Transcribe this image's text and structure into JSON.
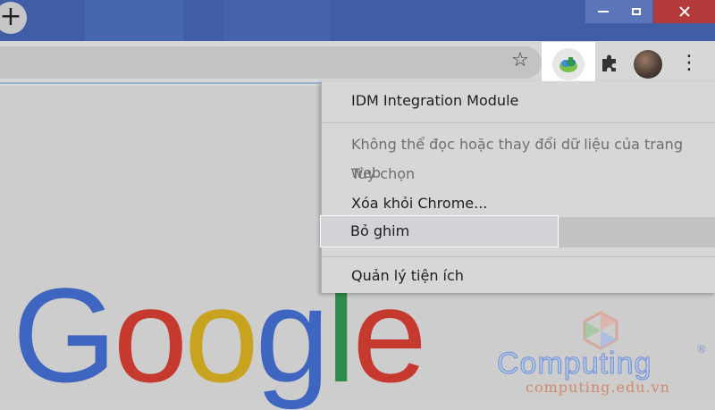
{
  "browser": {
    "new_tab_label": "+",
    "window_controls": {
      "minimize": "minimize-icon",
      "maximize": "maximize-icon",
      "close": "close-icon"
    }
  },
  "toolbar": {
    "bookmark_icon": "star-icon",
    "extension_icon": "idm-icon",
    "extensions_menu_icon": "puzzle-icon",
    "menu_icon": "⋮"
  },
  "context_menu": {
    "title": "IDM Integration Module",
    "items": [
      {
        "label": "Không thể đọc hoặc thay đổi dữ liệu của trang web",
        "enabled": false
      },
      {
        "label": "Tùy chọn",
        "enabled": false
      },
      {
        "label": "Xóa khỏi Chrome...",
        "enabled": true
      },
      {
        "label": "Bỏ ghim",
        "enabled": true,
        "highlighted": true
      },
      {
        "label": "Quản lý tiện ích",
        "enabled": true
      }
    ]
  },
  "page": {
    "logo_letters": [
      "G",
      "o",
      "o",
      "g",
      "l",
      "e"
    ]
  },
  "watermark": {
    "brand": "Computing",
    "registered": "®",
    "url": "computing.edu.vn"
  },
  "colors": {
    "google_blue": "#3e66c0",
    "google_red": "#c6392f",
    "google_yellow": "#c9a21f",
    "google_green": "#2f8b49"
  }
}
